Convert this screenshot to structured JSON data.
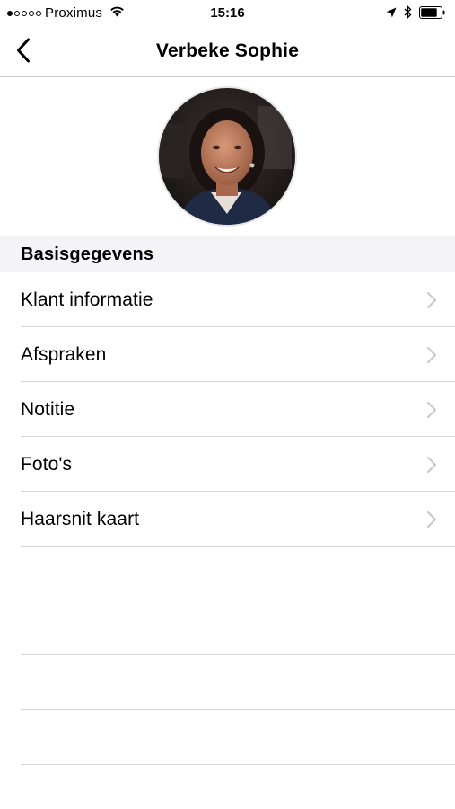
{
  "status_bar": {
    "carrier": "Proximus",
    "time": "15:16",
    "signal_bars_filled": 1,
    "signal_bars_total": 5
  },
  "nav": {
    "title": "Verbeke Sophie",
    "back_icon": "chevron-left-icon"
  },
  "profile": {
    "avatar_icon": "profile-photo"
  },
  "section": {
    "title": "Basisgegevens"
  },
  "menu": {
    "items": [
      {
        "label": "Klant informatie"
      },
      {
        "label": "Afspraken"
      },
      {
        "label": "Notitie"
      },
      {
        "label": "Foto's"
      },
      {
        "label": "Haarsnit kaart"
      }
    ]
  },
  "colors": {
    "separator": "#d6d6da",
    "section_bg": "#f4f4f6",
    "chevron": "#c7c7cc"
  }
}
